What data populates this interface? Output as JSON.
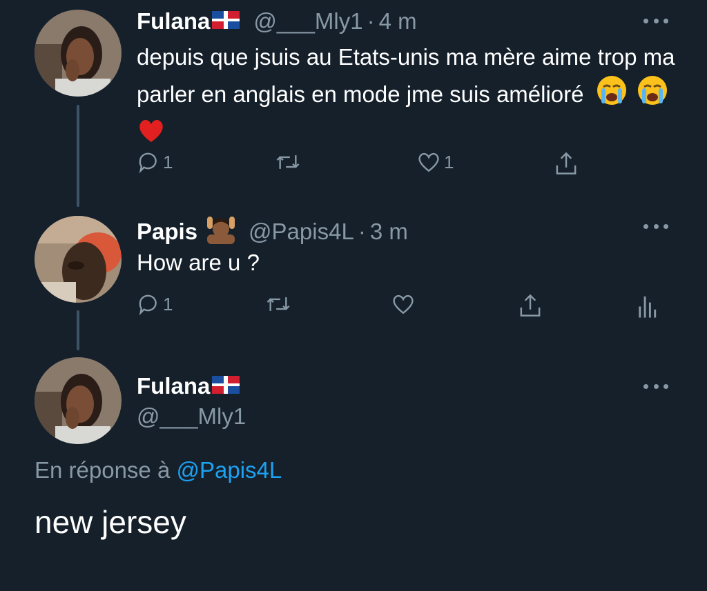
{
  "tweets": [
    {
      "name": "Fulana",
      "handle": "@___Mly1",
      "time": "4 m",
      "text": "depuis que jsuis au Etats-unis ma mère aime trop ma parler en anglais en mode jme suis amélioré",
      "reply_count": "1",
      "like_count": "1"
    },
    {
      "name": "Papis",
      "handle": "@Papis4L",
      "time": "3 m",
      "text": "How are u ?",
      "reply_count": "1"
    }
  ],
  "focused": {
    "name": "Fulana",
    "handle": "@___Mly1",
    "reply_prefix": "En réponse à",
    "reply_target": "@Papis4L",
    "text": "new jersey"
  },
  "icons": {
    "reply": "reply-icon",
    "retweet": "retweet-icon",
    "like": "heart-icon",
    "share": "share-icon",
    "analytics": "analytics-icon",
    "more": "more-icon",
    "flag": "dominican-flag-icon"
  },
  "colors": {
    "background": "#15202b",
    "secondary_text": "#8899a6",
    "link": "#1da1f2",
    "thread_line": "#3d5466"
  }
}
